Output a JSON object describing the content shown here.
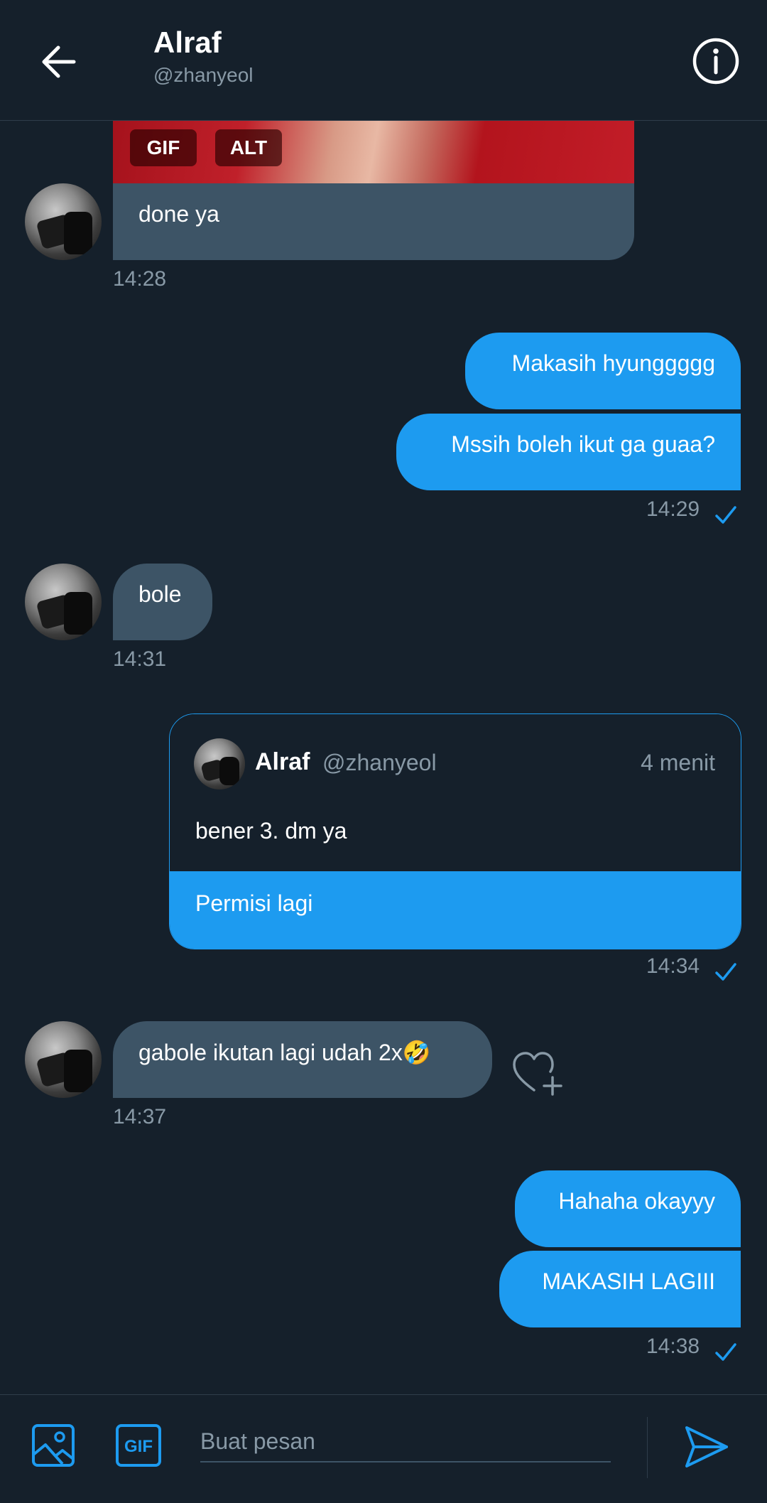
{
  "header": {
    "name": "Alraf",
    "handle": "@zhanyeol"
  },
  "gif": {
    "tag_gif": "GIF",
    "tag_alt": "ALT"
  },
  "messages": [
    {
      "text": "done ya",
      "time": "14:28"
    },
    {
      "text": "Makasih hyunggggg"
    },
    {
      "text": "Mssih boleh ikut ga guaa?",
      "time": "14:29"
    },
    {
      "text": "bole",
      "time": "14:31"
    },
    {
      "time": "14:34"
    },
    {
      "text": "gabole ikutan lagi udah 2x🤣",
      "time": "14:37"
    },
    {
      "text": "Hahaha okayyy"
    },
    {
      "text": "MAKASIH LAGIII",
      "time": "14:38"
    }
  ],
  "quote": {
    "name": "Alraf",
    "handle": "@zhanyeol",
    "age": "4 menit",
    "quoted_text": "bener 3. dm ya",
    "reply_text": "Permisi lagi"
  },
  "composer": {
    "placeholder": "Buat pesan"
  },
  "colors": {
    "background": "#15202b",
    "accent": "#1d9bf0",
    "incoming_bubble": "#3d5466",
    "muted_text": "#8899a6"
  },
  "icons": [
    "arrow-left-icon",
    "info-icon",
    "image-icon",
    "gif-icon",
    "send-icon",
    "checkmark-icon",
    "heart-plus-icon"
  ]
}
